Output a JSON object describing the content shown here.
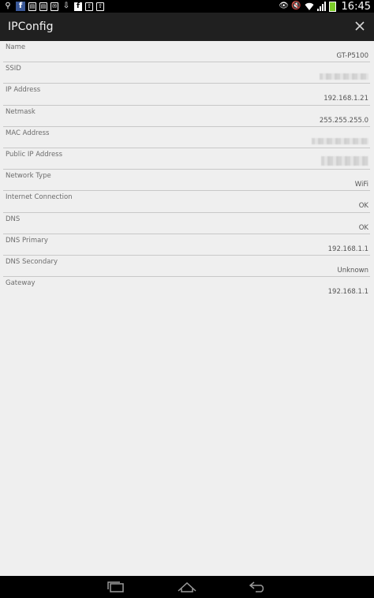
{
  "status_bar": {
    "time": "16:45",
    "notification_icons": [
      "usb-icon",
      "facebook-icon",
      "document-icon",
      "document-icon",
      "email-icon",
      "download-icon",
      "facebook-icon",
      "upload-icon",
      "upload-icon"
    ],
    "system_icons": [
      "eye-icon",
      "mute-icon",
      "wifi-icon",
      "signal-icon",
      "battery-icon"
    ],
    "battery_color": "#7ccc2a"
  },
  "action_bar": {
    "title": "IPConfig"
  },
  "rows": [
    {
      "label": "Name",
      "value": "GT-P5100",
      "redacted": false
    },
    {
      "label": "SSID",
      "value": "",
      "redacted": true
    },
    {
      "label": "IP Address",
      "value": "192.168.1.21",
      "redacted": false
    },
    {
      "label": "Netmask",
      "value": "255.255.255.0",
      "redacted": false
    },
    {
      "label": "MAC Address",
      "value": "",
      "redacted": true
    },
    {
      "label": "Public IP Address",
      "value": "",
      "redacted": true
    },
    {
      "label": "Network Type",
      "value": "WiFi",
      "redacted": false
    },
    {
      "label": "Internet Connection",
      "value": "OK",
      "redacted": false
    },
    {
      "label": "DNS",
      "value": "OK",
      "redacted": false
    },
    {
      "label": "DNS Primary",
      "value": "192.168.1.1",
      "redacted": false
    },
    {
      "label": "DNS Secondary",
      "value": "Unknown",
      "redacted": false
    },
    {
      "label": "Gateway",
      "value": "192.168.1.1",
      "redacted": false
    }
  ],
  "nav_bar": {
    "buttons": [
      "recent-apps-icon",
      "home-icon",
      "back-icon"
    ]
  },
  "colors": {
    "action_bar_bg": "#202020",
    "content_bg": "#efefef",
    "divider": "#c8c8c8"
  }
}
